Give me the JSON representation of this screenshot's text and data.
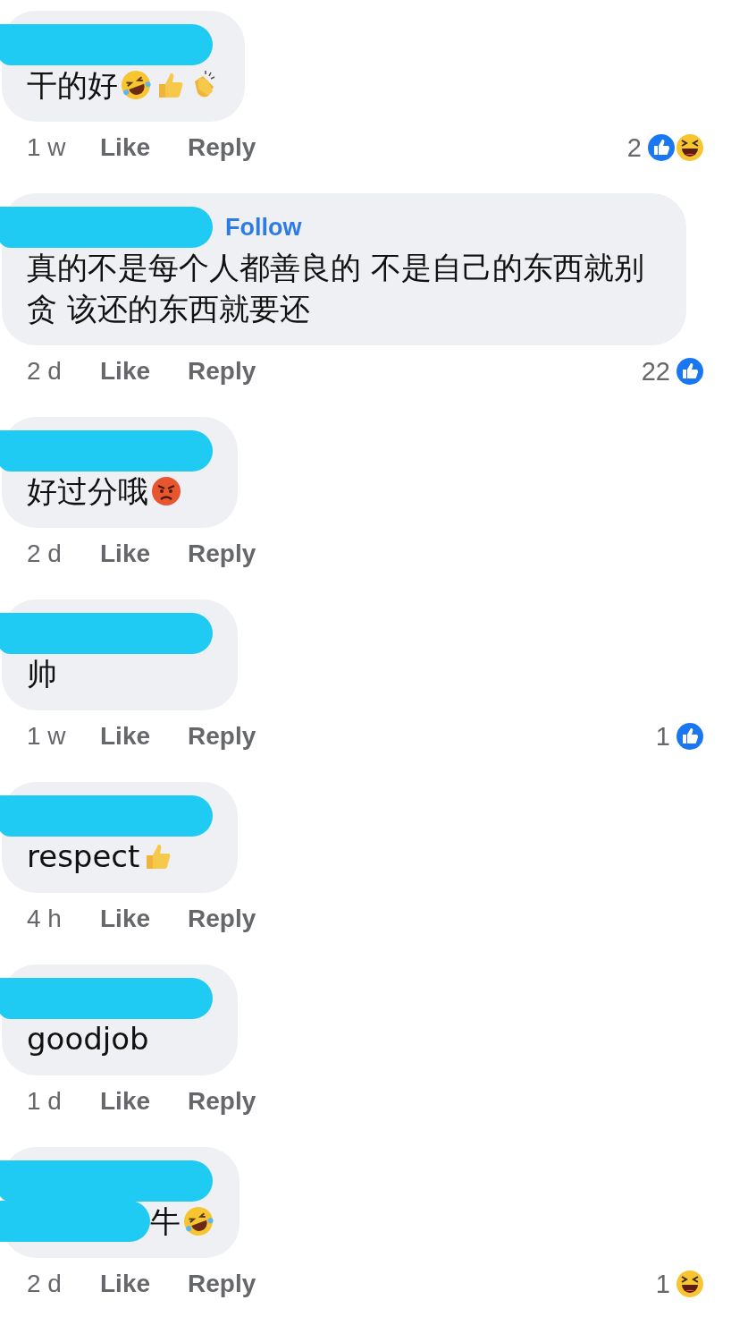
{
  "comments": [
    {
      "author": {
        "redacted": true
      },
      "text": "干的好",
      "emojis": [
        {
          "kind": "rofl"
        },
        {
          "kind": "thumbs_up"
        },
        {
          "kind": "clap"
        }
      ],
      "time": "1 w",
      "like": "Like",
      "reply": "Reply",
      "reactions": {
        "count": "2",
        "types": [
          {
            "kind": "like"
          },
          {
            "kind": "haha"
          }
        ]
      }
    },
    {
      "author": {
        "redacted": true
      },
      "follow": "Follow",
      "text": "真的不是每个人都善良的 不是自己的东西就别贪 该还的东西就要还",
      "time": "2 d",
      "like": "Like",
      "reply": "Reply",
      "reactions": {
        "count": "22",
        "types": [
          {
            "kind": "like"
          }
        ]
      }
    },
    {
      "author": {
        "redacted": true
      },
      "text": "好过分哦",
      "emojis": [
        {
          "kind": "angry"
        }
      ],
      "time": "2 d",
      "like": "Like",
      "reply": "Reply"
    },
    {
      "author": {
        "redacted": true
      },
      "text": "帅",
      "time": "1 w",
      "like": "Like",
      "reply": "Reply",
      "reactions": {
        "count": "1",
        "types": [
          {
            "kind": "like"
          }
        ]
      }
    },
    {
      "author": {
        "redacted": true
      },
      "text": "respect",
      "emojis": [
        {
          "kind": "thumbs_up"
        }
      ],
      "time": "4 h",
      "like": "Like",
      "reply": "Reply"
    },
    {
      "author": {
        "redacted": true
      },
      "text": "goodjob",
      "time": "1 d",
      "like": "Like",
      "reply": "Reply"
    },
    {
      "author": {
        "redacted": true
      },
      "text": "牛",
      "text_redacted": true,
      "emojis": [
        {
          "kind": "rofl"
        }
      ],
      "time": "2 d",
      "like": "Like",
      "reply": "Reply",
      "reactions": {
        "count": "1",
        "types": [
          {
            "kind": "haha"
          }
        ]
      }
    }
  ]
}
